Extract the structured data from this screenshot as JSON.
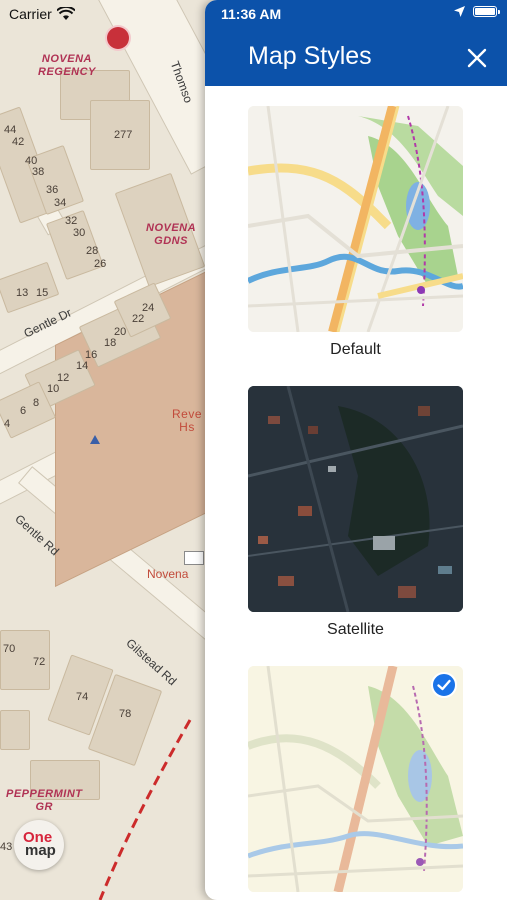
{
  "status_bar": {
    "carrier": "Carrier",
    "time": "11:36 AM"
  },
  "panel": {
    "title": "Map Styles",
    "styles": [
      {
        "label": "Default",
        "selected": false
      },
      {
        "label": "Satellite",
        "selected": false
      },
      {
        "label": "",
        "selected": true
      }
    ]
  },
  "map": {
    "places": {
      "novena_regency": [
        "NOVENA",
        "REGENCY"
      ],
      "novena_gdns": [
        "NOVENA",
        "GDNS"
      ],
      "peppermint_gr": [
        "PEPPERMINT",
        "GR"
      ],
      "reve": [
        "Reve",
        "Hs"
      ]
    },
    "roads": {
      "thomson": "Thomso",
      "gentle_dr": "Gentle Dr",
      "gentle_rd": "Gentle Rd",
      "gilstead_rd": "Gilstead Rd"
    },
    "poi": {
      "novena": "Novena"
    },
    "house_numbers": {
      "n277": "277",
      "n44": "44",
      "n42": "42",
      "n40": "40",
      "n38": "38",
      "n36": "36",
      "n34": "34",
      "n32": "32",
      "n30": "30",
      "n28": "28",
      "n26": "26",
      "n13": "13",
      "n15": "15",
      "n24": "24",
      "n22": "22",
      "n20": "20",
      "n18": "18",
      "n16": "16",
      "n14": "14",
      "n12": "12",
      "n10": "10",
      "n8": "8",
      "n6": "6",
      "n4": "4",
      "n70": "70",
      "n72": "72",
      "n74": "74",
      "n78": "78",
      "n43": "43"
    },
    "logo": {
      "line1": "One",
      "line2": "map"
    }
  },
  "colors": {
    "header": "#0c52aa",
    "check": "#1a73e8",
    "place": "#b03254"
  }
}
